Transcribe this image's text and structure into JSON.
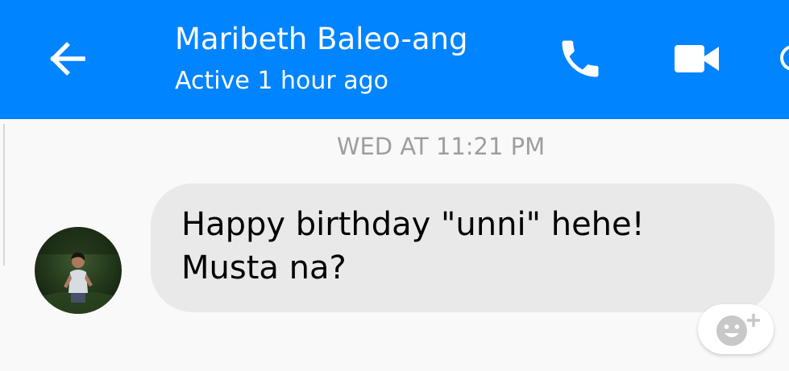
{
  "colors": {
    "header_bg": "#0084ff",
    "header_text": "#ffffff",
    "page_bg": "#f9f9f9",
    "incoming_bubble_bg": "#e9e9e9",
    "timestamp_text": "#9e9e9e"
  },
  "header": {
    "back_icon": "arrow-left-icon",
    "contact_name": "Maribeth Baleo-ang",
    "status": "Active 1 hour ago",
    "call_icon": "phone-icon",
    "video_icon": "video-camera-icon",
    "more_icon": "info-icon"
  },
  "conversation": {
    "timestamp": "WED AT 11:21 PM",
    "messages": [
      {
        "direction": "incoming",
        "avatar_icon": "contact-avatar-photo",
        "text": "Happy birthday \"unni\" hehe!\nMusta na?"
      }
    ]
  },
  "reaction_button": {
    "icon": "smiley-add-icon"
  }
}
